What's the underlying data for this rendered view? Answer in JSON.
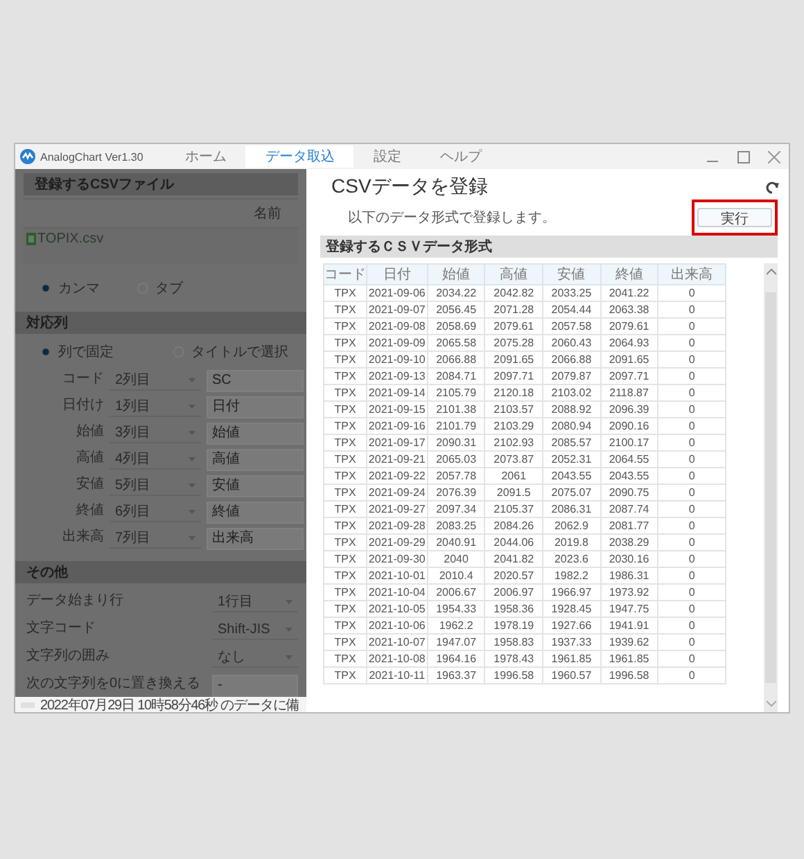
{
  "window": {
    "title": "AnalogChart Ver1.30",
    "tabs": [
      {
        "label": "ホーム",
        "selected": false
      },
      {
        "label": "データ取込",
        "selected": true
      },
      {
        "label": "設定",
        "selected": false
      },
      {
        "label": "ヘルプ",
        "selected": false
      }
    ]
  },
  "left_panel": {
    "file_section": {
      "title": "登録するCSVファイル",
      "list_header": "名前",
      "files": [
        "TOPIX.csv"
      ],
      "delimiters": [
        {
          "label": "カンマ",
          "selected": true
        },
        {
          "label": "タブ",
          "selected": false
        }
      ]
    },
    "column_section": {
      "title": "対応列",
      "modes": [
        {
          "label": "列で固定",
          "selected": true
        },
        {
          "label": "タイトルで選択",
          "selected": false
        }
      ],
      "mappings": [
        {
          "label": "コード",
          "value": "2列目",
          "title": "SC"
        },
        {
          "label": "日付け",
          "value": "1列目",
          "title": "日付"
        },
        {
          "label": "始値",
          "value": "3列目",
          "title": "始値"
        },
        {
          "label": "高値",
          "value": "4列目",
          "title": "高値"
        },
        {
          "label": "安値",
          "value": "5列目",
          "title": "安値"
        },
        {
          "label": "終値",
          "value": "6列目",
          "title": "終値"
        },
        {
          "label": "出来高",
          "value": "7列目",
          "title": "出来高"
        }
      ]
    },
    "other_section": {
      "title": "その他",
      "settings": [
        {
          "kind": "select",
          "label": "データ始まり行",
          "value": "1行目"
        },
        {
          "kind": "select",
          "label": "文字コード",
          "value": "Shift-JIS"
        },
        {
          "kind": "select",
          "label": "文字列の囲み",
          "value": "なし"
        },
        {
          "kind": "input",
          "label": "次の文字列を0に置き換える",
          "value": "-"
        }
      ]
    }
  },
  "status_bar": {
    "progress": {
      "level": 0
    },
    "text": "2022年07月29日 10時58分46秒 のデータに備"
  },
  "main": {
    "title": "CSVデータを登録",
    "subtitle": "以下のデータ形式で登録します。",
    "run_button": {
      "label": "実行",
      "highlighted": true
    },
    "format_title": "登録するＣＳＶデータ形式",
    "table": {
      "columns": [
        "コード",
        "日付",
        "始値",
        "高値",
        "安値",
        "終値",
        "出来高"
      ],
      "rows": [
        [
          "TPX",
          "2021-09-06",
          "2034.22",
          "2042.82",
          "2033.25",
          "2041.22",
          "0"
        ],
        [
          "TPX",
          "2021-09-07",
          "2056.45",
          "2071.28",
          "2054.44",
          "2063.38",
          "0"
        ],
        [
          "TPX",
          "2021-09-08",
          "2058.69",
          "2079.61",
          "2057.58",
          "2079.61",
          "0"
        ],
        [
          "TPX",
          "2021-09-09",
          "2065.58",
          "2075.28",
          "2060.43",
          "2064.93",
          "0"
        ],
        [
          "TPX",
          "2021-09-10",
          "2066.88",
          "2091.65",
          "2066.88",
          "2091.65",
          "0"
        ],
        [
          "TPX",
          "2021-09-13",
          "2084.71",
          "2097.71",
          "2079.87",
          "2097.71",
          "0"
        ],
        [
          "TPX",
          "2021-09-14",
          "2105.79",
          "2120.18",
          "2103.02",
          "2118.87",
          "0"
        ],
        [
          "TPX",
          "2021-09-15",
          "2101.38",
          "2103.57",
          "2088.92",
          "2096.39",
          "0"
        ],
        [
          "TPX",
          "2021-09-16",
          "2101.79",
          "2103.29",
          "2080.94",
          "2090.16",
          "0"
        ],
        [
          "TPX",
          "2021-09-17",
          "2090.31",
          "2102.93",
          "2085.57",
          "2100.17",
          "0"
        ],
        [
          "TPX",
          "2021-09-21",
          "2065.03",
          "2073.87",
          "2052.31",
          "2064.55",
          "0"
        ],
        [
          "TPX",
          "2021-09-22",
          "2057.78",
          "2061",
          "2043.55",
          "2043.55",
          "0"
        ],
        [
          "TPX",
          "2021-09-24",
          "2076.39",
          "2091.5",
          "2075.07",
          "2090.75",
          "0"
        ],
        [
          "TPX",
          "2021-09-27",
          "2097.34",
          "2105.37",
          "2086.31",
          "2087.74",
          "0"
        ],
        [
          "TPX",
          "2021-09-28",
          "2083.25",
          "2084.26",
          "2062.9",
          "2081.77",
          "0"
        ],
        [
          "TPX",
          "2021-09-29",
          "2040.91",
          "2044.06",
          "2019.8",
          "2038.29",
          "0"
        ],
        [
          "TPX",
          "2021-09-30",
          "2040",
          "2041.82",
          "2023.6",
          "2030.16",
          "0"
        ],
        [
          "TPX",
          "2021-10-01",
          "2010.4",
          "2020.57",
          "1982.2",
          "1986.31",
          "0"
        ],
        [
          "TPX",
          "2021-10-04",
          "2006.67",
          "2006.97",
          "1966.97",
          "1973.92",
          "0"
        ],
        [
          "TPX",
          "2021-10-05",
          "1954.33",
          "1958.36",
          "1928.45",
          "1947.75",
          "0"
        ],
        [
          "TPX",
          "2021-10-06",
          "1962.2",
          "1978.19",
          "1927.66",
          "1941.91",
          "0"
        ],
        [
          "TPX",
          "2021-10-07",
          "1947.07",
          "1958.83",
          "1937.33",
          "1939.62",
          "0"
        ],
        [
          "TPX",
          "2021-10-08",
          "1964.16",
          "1978.43",
          "1961.85",
          "1961.85",
          "0"
        ],
        [
          "TPX",
          "2021-10-11",
          "1963.37",
          "1996.58",
          "1960.57",
          "1996.58",
          "0"
        ]
      ]
    }
  }
}
